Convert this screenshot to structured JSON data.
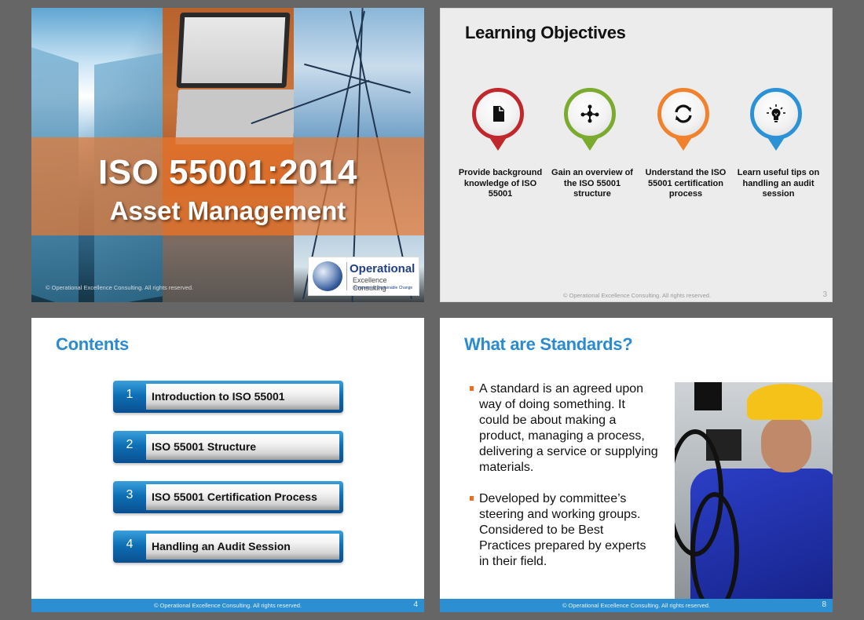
{
  "slides": [
    {
      "title_line1": "ISO 55001:2014",
      "title_line2": "Asset Management",
      "copyright": "© Operational Excellence Consulting.  All rights reserved.",
      "logo": {
        "main": "Operational",
        "sub": "Excellence Consulting",
        "tagline": "Empowering Sustainable Change"
      }
    },
    {
      "title": "Learning Objectives",
      "objectives": [
        {
          "icon": "document-icon",
          "color": "#c0282d",
          "text": "Provide background knowledge of ISO 55001"
        },
        {
          "icon": "network-icon",
          "color": "#7aab2f",
          "text": "Gain an overview of the ISO 55001 structure"
        },
        {
          "icon": "refresh-icon",
          "color": "#f0822d",
          "text": "Understand the ISO 55001 certification process"
        },
        {
          "icon": "lightbulb-icon",
          "color": "#2b93d5",
          "text": "Learn useful tips on handling an audit session"
        }
      ],
      "copyright": "© Operational Excellence Consulting.  All rights reserved.",
      "page_number": "3"
    },
    {
      "title": "Contents",
      "items": [
        {
          "number": "1",
          "label": "Introduction to ISO 55001"
        },
        {
          "number": "2",
          "label": "ISO 55001 Structure"
        },
        {
          "number": "3",
          "label": "ISO 55001 Certification Process"
        },
        {
          "number": "4",
          "label": "Handling an Audit Session"
        }
      ],
      "copyright": "© Operational Excellence Consulting.  All rights reserved.",
      "page_number": "4"
    },
    {
      "title": "What are Standards?",
      "bullets": [
        "A standard is an agreed upon way of doing something. It could be about making a product, managing a process, delivering a service or supplying materials.",
        "Developed by committee’s steering and working groups. Considered to be Best Practices prepared by experts in their field."
      ],
      "copyright": "© Operational Excellence Consulting.  All rights reserved.",
      "page_number": "8"
    }
  ],
  "colors": {
    "background": "#666666",
    "title_blue": "#2a8bd0",
    "footer_blue": "#2b8fd1",
    "bullet_orange": "#e8701f",
    "title_band_orange": "#e87832"
  }
}
